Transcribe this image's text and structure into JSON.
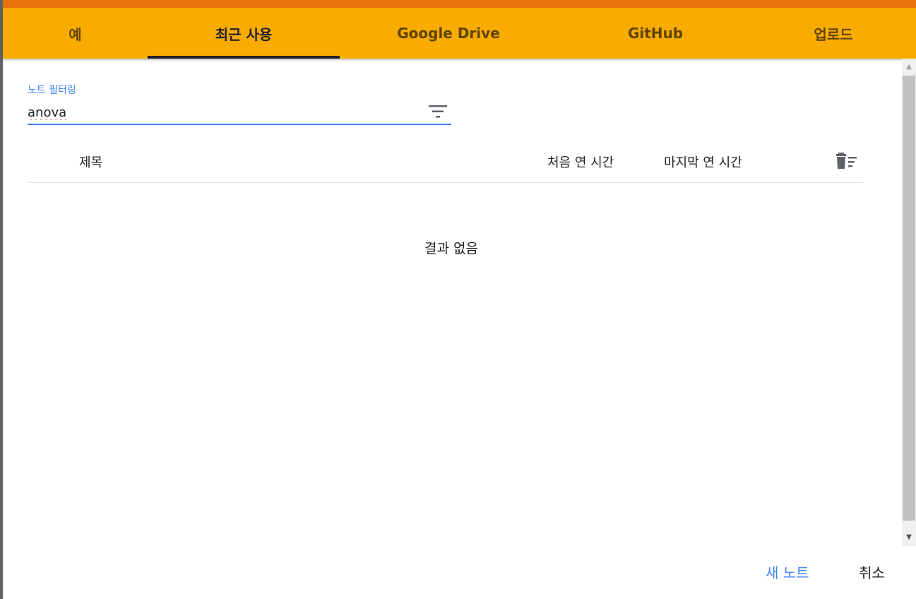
{
  "tabs": [
    {
      "label": "예"
    },
    {
      "label": "최근 사용",
      "active": true
    },
    {
      "label": "Google Drive"
    },
    {
      "label": "GitHub"
    },
    {
      "label": "업로드"
    }
  ],
  "filter": {
    "label": "노트 필터링",
    "value": "anova",
    "icon": "filter-list-icon"
  },
  "table": {
    "columns": [
      "제목",
      "처음 연 시간",
      "마지막 연 시간"
    ],
    "delete_icon": "delete-sweep-icon",
    "empty_message": "결과 없음"
  },
  "footer": {
    "new_notebook": "새 노트",
    "cancel": "취소"
  },
  "colors": {
    "tabbar": "#f9ab00",
    "top_strip": "#e8710a",
    "accent": "#4285f4"
  }
}
